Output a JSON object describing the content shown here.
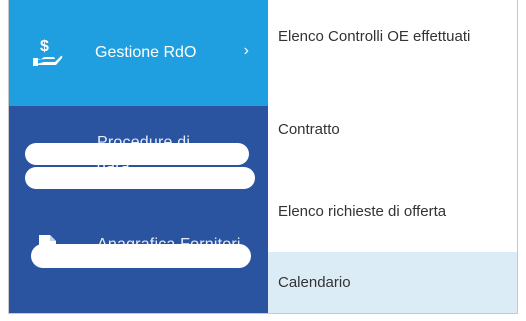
{
  "sidebar": {
    "active_item": {
      "label": "Gestione RdO",
      "icon": "hand-coin-icon",
      "chevron": "›"
    },
    "redacted_item_1": {
      "label_fragment_top": "Procedure di",
      "label_fragment_bottom": "gara"
    },
    "redacted_item_2": {
      "label_fragment": "Anagrafica Fornitori",
      "icon": "document-icon"
    }
  },
  "submenu": {
    "items": [
      {
        "label": "Elenco Controlli OE effettuati",
        "highlighted": false
      },
      {
        "label": "Contratto",
        "highlighted": false
      },
      {
        "label": "Elenco richieste di offerta",
        "highlighted": false
      },
      {
        "label": "Calendario",
        "highlighted": true
      }
    ]
  },
  "colors": {
    "sidebar": "#2a54a0",
    "active": "#1f9ee0",
    "highlight": "#dcecf7",
    "text": "#333333"
  }
}
